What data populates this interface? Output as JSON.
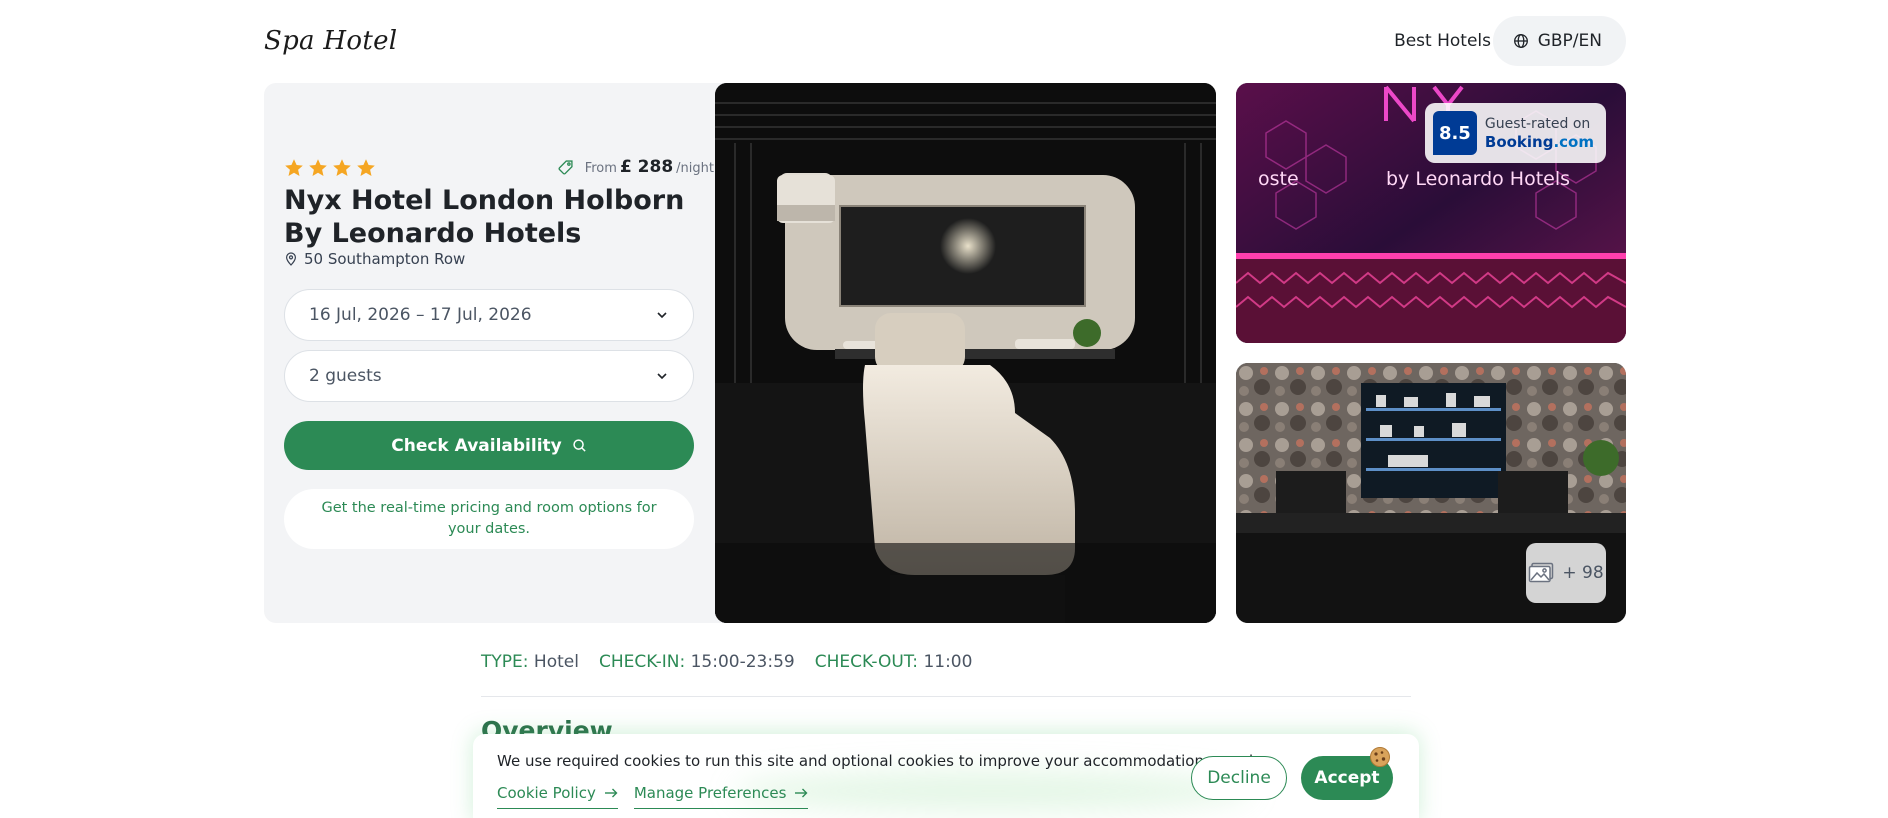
{
  "header": {
    "logo": "Spa Hotel",
    "nav_best": "Best Hotels",
    "nav_lang": "GBP/EN",
    "globe_icon": "globe-icon"
  },
  "hotel": {
    "stars": 4,
    "star_color": "#f5a623",
    "price_from": "From",
    "price_amount": "£ 288",
    "price_per": "/night",
    "name": "Nyx Hotel London Holborn By Leonardo Hotels",
    "address": "50 Southampton Row"
  },
  "booking": {
    "dates": "16 Jul, 2026 – 17 Jul, 2026",
    "guests": "2 guests",
    "check_label": "Check Availability",
    "note": "Get the real-time pricing and room options for your dates."
  },
  "photos": {
    "rating_score": "8.5",
    "rating_label": "Guest-rated on",
    "booking_brand_main": "Booking",
    "booking_brand_tld": ".com",
    "more_count": "+ 98"
  },
  "info": {
    "type_label": "TYPE:",
    "type_value": "Hotel",
    "checkin_label": "CHECK-IN:",
    "checkin_value": "15:00-23:59",
    "checkout_label": "CHECK-OUT:",
    "checkout_value": "11:00"
  },
  "overview": {
    "title": "Overview"
  },
  "cookie": {
    "text": "We use required cookies to run this site and optional cookies to improve your accommodation search.",
    "policy_link": "Cookie Policy",
    "preferences_link": "Manage Preferences",
    "decline": "Decline",
    "accept": "Accept"
  },
  "colors": {
    "brand_green": "#2c8a55",
    "booking_blue": "#003b95",
    "card_bg": "#f3f4f6"
  }
}
